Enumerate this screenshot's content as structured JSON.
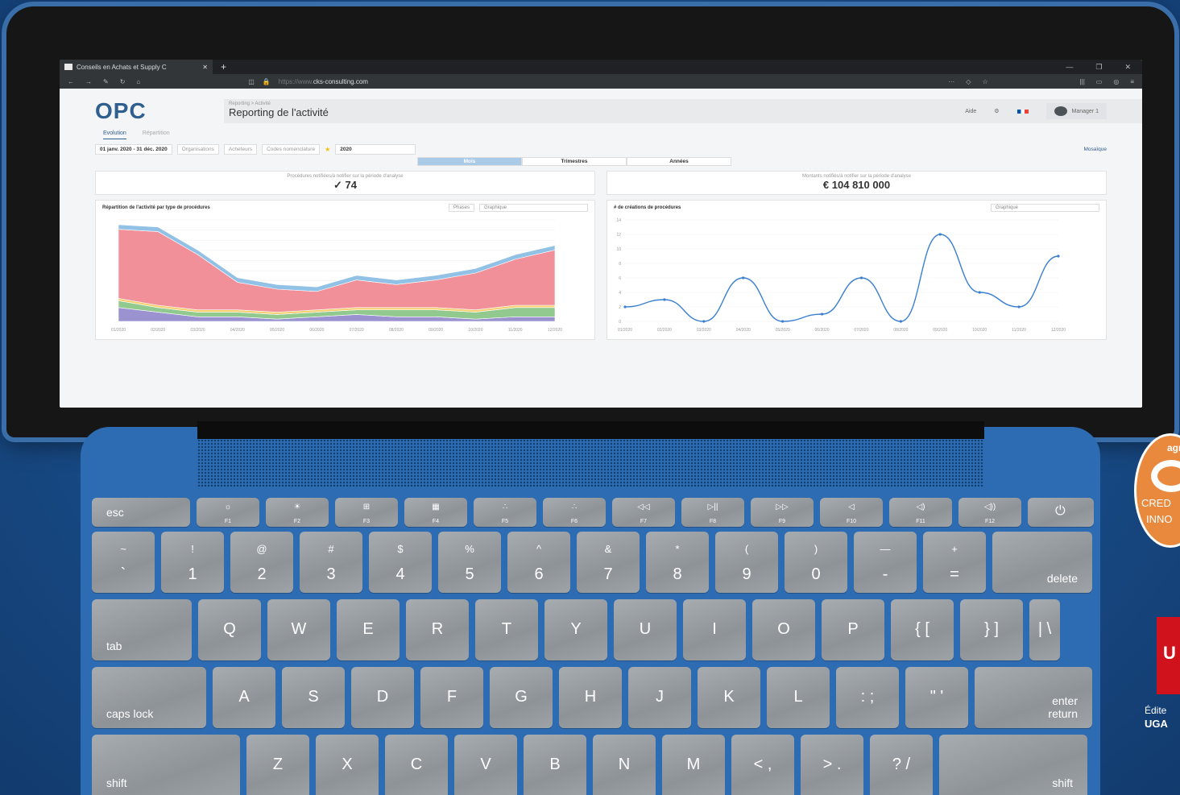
{
  "browser": {
    "tab_title": "Conseils en Achats et Supply C",
    "tab_close": "✕",
    "new_tab": "+",
    "url_prefix": "https://www.",
    "url_host": "cks-consulting.com",
    "window_minimize": "—",
    "window_restore": "❐",
    "window_close": "✕"
  },
  "app": {
    "logo": "OPC",
    "breadcrumb": "Reporting > Activité",
    "page_title": "Reporting de l'activité",
    "help": "Aide",
    "user": "Manager 1",
    "subtabs": [
      "Evolution",
      "Répartition"
    ],
    "filters": {
      "date_range": "01 janv. 2020 - 31 déc. 2020",
      "organisations": "Organisations",
      "acheteurs": "Acheteurs",
      "codes": "Codes nomenclature",
      "year": "2020",
      "mosaic": "Mosaïque"
    },
    "periods": [
      "Mois",
      "Trimestres",
      "Années"
    ],
    "kpi_left_label": "Procédures notifiées/à notifier sur la période d'analyse",
    "kpi_left_value": "74",
    "kpi_right_label": "Montants notifiés/à notifier sur la période d'analyse",
    "kpi_right_value": "€ 104 810 000",
    "chart_left_title": "Répartition de l'activité par type de procédures",
    "chart_left_sel1": "Phases",
    "chart_left_sel2": "Graphique",
    "chart_right_title": "# de créations de procédures",
    "chart_right_sel": "Graphique"
  },
  "chart_data": [
    {
      "type": "area",
      "title": "Répartition de l'activité par type de procédures",
      "x": [
        "01/2020",
        "02/2020",
        "03/2020",
        "04/2020",
        "05/2020",
        "06/2020",
        "07/2020",
        "08/2020",
        "09/2020",
        "10/2020",
        "11/2020",
        "12/2020"
      ],
      "series": [
        {
          "color": "#8a7fc8",
          "values": [
            30,
            20,
            10,
            10,
            5,
            10,
            15,
            10,
            10,
            5,
            10,
            10
          ]
        },
        {
          "color": "#7ec07a",
          "values": [
            15,
            10,
            10,
            10,
            10,
            10,
            10,
            15,
            15,
            15,
            20,
            20
          ]
        },
        {
          "color": "#f3c85a",
          "values": [
            5,
            5,
            5,
            5,
            5,
            5,
            5,
            5,
            5,
            5,
            5,
            5
          ]
        },
        {
          "color": "#ee7d86",
          "values": [
            150,
            160,
            120,
            60,
            50,
            40,
            60,
            50,
            60,
            80,
            100,
            120
          ]
        },
        {
          "color": "#7fb6e2",
          "values": [
            10,
            10,
            10,
            10,
            10,
            10,
            10,
            10,
            10,
            10,
            10,
            10
          ]
        }
      ]
    },
    {
      "type": "line",
      "title": "# de créations de procédures",
      "x": [
        "01/2020",
        "02/2020",
        "03/2020",
        "04/2020",
        "05/2020",
        "06/2020",
        "07/2020",
        "08/2020",
        "09/2020",
        "10/2020",
        "11/2020",
        "12/2020"
      ],
      "ylim": [
        0,
        14
      ],
      "yticks": [
        0,
        2,
        4,
        6,
        8,
        10,
        12,
        14
      ],
      "values": [
        2,
        3,
        0,
        6,
        0,
        1,
        6,
        0,
        12,
        4,
        2,
        9
      ],
      "color": "#3a7fd1"
    }
  ],
  "keyboard": {
    "fn_row": [
      {
        "icon": "esc",
        "fn": ""
      },
      {
        "icon": "☼",
        "fn": "F1"
      },
      {
        "icon": "☀",
        "fn": "F2"
      },
      {
        "icon": "⊞",
        "fn": "F3"
      },
      {
        "icon": "▦",
        "fn": "F4"
      },
      {
        "icon": "∴",
        "fn": "F5"
      },
      {
        "icon": "∴",
        "fn": "F6"
      },
      {
        "icon": "◁◁",
        "fn": "F7"
      },
      {
        "icon": "▷||",
        "fn": "F8"
      },
      {
        "icon": "▷▷",
        "fn": "F9"
      },
      {
        "icon": "◁",
        "fn": "F10"
      },
      {
        "icon": "◁)",
        "fn": "F11"
      },
      {
        "icon": "◁))",
        "fn": "F12"
      },
      {
        "icon": "⏻",
        "fn": ""
      }
    ],
    "num_row": [
      {
        "top": "~",
        "main": "`"
      },
      {
        "top": "!",
        "main": "1"
      },
      {
        "top": "@",
        "main": "2"
      },
      {
        "top": "#",
        "main": "3"
      },
      {
        "top": "$",
        "main": "4"
      },
      {
        "top": "%",
        "main": "5"
      },
      {
        "top": "^",
        "main": "6"
      },
      {
        "top": "&",
        "main": "7"
      },
      {
        "top": "*",
        "main": "8"
      },
      {
        "top": "(",
        "main": "9"
      },
      {
        "top": ")",
        "main": "0"
      },
      {
        "top": "—",
        "main": "-"
      },
      {
        "top": "+",
        "main": "="
      },
      {
        "top": "",
        "main": "delete"
      }
    ],
    "q_row": [
      "tab",
      "Q",
      "W",
      "E",
      "R",
      "T",
      "Y",
      "U",
      "I",
      "O",
      "P",
      "{ [",
      "} ]",
      "| \\"
    ],
    "a_row": [
      "caps lock",
      "A",
      "S",
      "D",
      "F",
      "G",
      "H",
      "J",
      "K",
      "L",
      ": ;",
      "\" '",
      "enter return"
    ],
    "z_row": [
      "shift",
      "Z",
      "X",
      "C",
      "V",
      "B",
      "N",
      "M",
      "< ,",
      "> .",
      "? /",
      "shift"
    ]
  },
  "badges": {
    "agreement_top": "agr",
    "agreement_line1": "CRED",
    "agreement_line2": "INNO",
    "ugap_letter": "U",
    "editeur": "Édite",
    "ugap": "UGA"
  }
}
